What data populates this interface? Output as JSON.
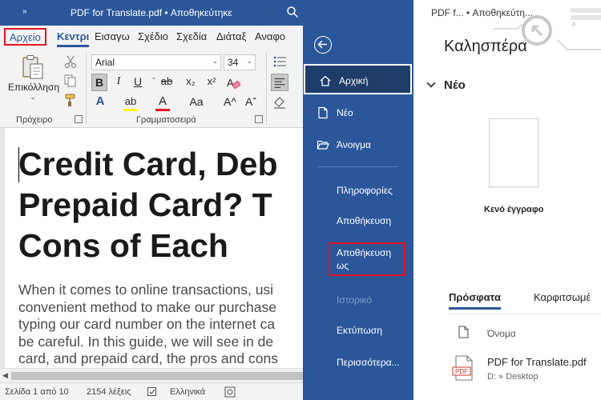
{
  "window": {
    "title": "PDF for Translate.pdf • Αποθηκεύτηκε",
    "qat_label": "»",
    "content_title": "PDF f... • Αποθηκεύτη..."
  },
  "ribbon_tabs": {
    "file": "Αρχείο",
    "home": "Κεντρι",
    "insert": "Εισαγω",
    "draw": "Σχέδιο",
    "design": "Σχεδία",
    "layout": "Διάταξ",
    "references": "Αναφο"
  },
  "clipboard": {
    "paste_label": "Επικόλληση",
    "paste_chevron": "⌄",
    "group_label": "Πρόχειρο"
  },
  "font": {
    "name": "Arial",
    "size": "34",
    "dropdown_arrow": "⌄",
    "bold": "B",
    "italic": "I",
    "underline": "U",
    "strikethrough": "ab",
    "subscript": "x₂",
    "superscript": "x²",
    "text_effects": "A",
    "highlight": "ab",
    "font_color": "A",
    "change_case": "Aa",
    "grow": "A^",
    "shrink": "Aˇ",
    "group_label": "Γραμματοσειρά",
    "font_color_hex": "#e81123",
    "highlight_hex": "#ffff00"
  },
  "document": {
    "heading_lines": [
      "Credit Card, Deb",
      "Prepaid Card? T",
      "Cons of Each"
    ],
    "body_lines": [
      "When it comes to online transactions, usi",
      "convenient method to make our purchase",
      "typing our card number on the internet ca",
      "be careful. In this guide, we will see in de",
      "card, and prepaid card, the pros and cons"
    ]
  },
  "status": {
    "page": "Σελίδα 1 από 10",
    "words": "2154 λέξεις",
    "language": "Ελληνικά"
  },
  "backstage": {
    "home": "Αρχική",
    "new": "Νέο",
    "open": "Άνοιγμα",
    "info": "Πληροφορίες",
    "save": "Αποθήκευση",
    "save_as": "Αποθήκευση ως",
    "history": "Ιστορικό",
    "print": "Εκτύπωση",
    "more": "Περισσότερα...",
    "accent_hex": "#2b579a"
  },
  "content": {
    "greeting": "Καλησπέρα",
    "new_section": "Νέο",
    "blank_label": "Κενό έγγραφο",
    "recent_tab": "Πρόσφατα",
    "pinned_tab": "Καρφιτσωμέ",
    "column_name": "Όνομα",
    "file_icon_label": "PDF",
    "file_name": "PDF for Translate.pdf",
    "file_path": "D: » Desktop"
  }
}
